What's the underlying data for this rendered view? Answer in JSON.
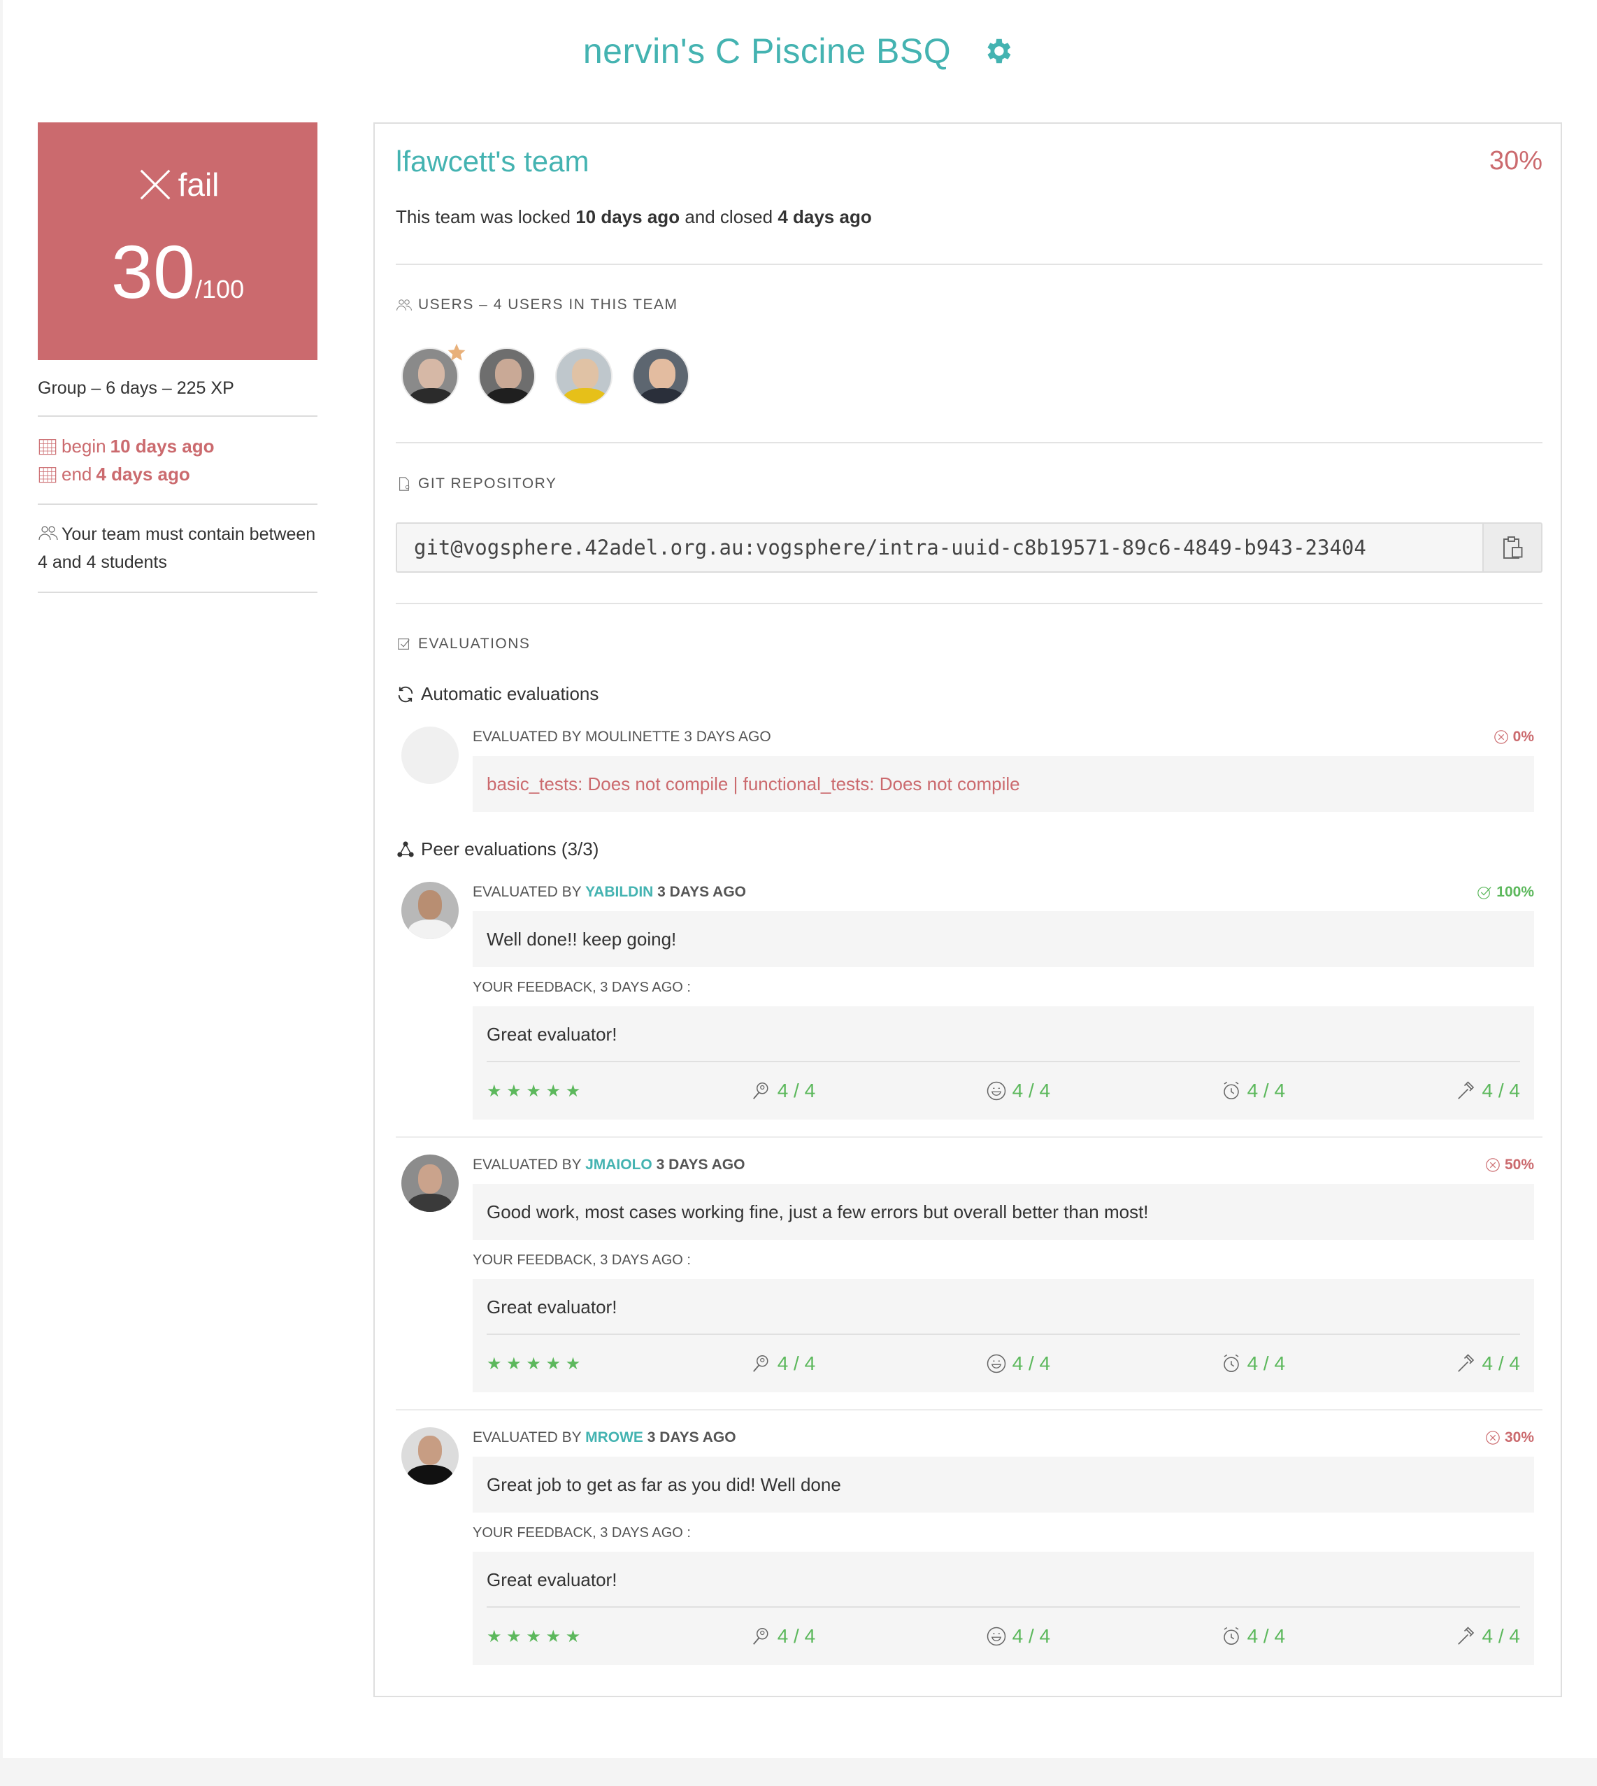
{
  "header": {
    "title": "nervin's C Piscine BSQ",
    "gear_icon": "gear-icon",
    "accent": "#44b3b1"
  },
  "mark": {
    "status": "fail",
    "score": "30",
    "denominator": "/100",
    "color": "#cb6a6e"
  },
  "sidebar": {
    "info": "Group – 6 days – 225 XP",
    "begin_label": "begin",
    "begin_value": "10 days ago",
    "end_label": "end",
    "end_value": "4 days ago",
    "team_size": "Your team must contain between 4 and 4 students"
  },
  "team": {
    "name": "lfawcett's team",
    "percent": "30%",
    "locked_prefix": "This team was locked",
    "locked_value": "10 days ago",
    "closed_prefix": "and closed",
    "closed_value": "4 days ago"
  },
  "users": {
    "label": "USERS – 4 USERS IN THIS TEAM",
    "avatars": [
      "user-avatar-1",
      "user-avatar-2",
      "user-avatar-3",
      "user-avatar-4"
    ]
  },
  "git": {
    "label": "GIT REPOSITORY",
    "url": "git@vogsphere.42adel.org.au:vogsphere/intra-uuid-c8b19571-89c6-4849-b943-23404",
    "copy_icon": "clipboard-icon"
  },
  "evaluations": {
    "label": "EVALUATIONS",
    "automatic_heading": "Automatic evaluations",
    "peer_heading": "Peer evaluations (3/3)",
    "automatic": {
      "title_prefix": "EVALUATED BY MOULINETTE 3 DAYS AGO",
      "score": "0%",
      "message": "basic_tests: Does not compile | functional_tests: Does not compile"
    },
    "peers": [
      {
        "prefix": "EVALUATED BY",
        "login": "YABILDIN",
        "ago": "3 DAYS AGO",
        "score": "100%",
        "status": "ok",
        "comment": "Well done!! keep going!",
        "feedback_label": "YOUR FEEDBACK, 3 DAYS AGO :",
        "feedback": "Great evaluator!",
        "stars": "★ ★ ★ ★ ★",
        "ratings": [
          "4 / 4",
          "4 / 4",
          "4 / 4",
          "4 / 4"
        ]
      },
      {
        "prefix": "EVALUATED BY",
        "login": "JMAIOLO",
        "ago": "3 DAYS AGO",
        "score": "50%",
        "status": "fail",
        "comment": "Good work, most cases working fine, just a few errors but overall better than most!",
        "feedback_label": "YOUR FEEDBACK, 3 DAYS AGO :",
        "feedback": "Great evaluator!",
        "stars": "★ ★ ★ ★ ★",
        "ratings": [
          "4 / 4",
          "4 / 4",
          "4 / 4",
          "4 / 4"
        ]
      },
      {
        "prefix": "EVALUATED BY",
        "login": "MROWE",
        "ago": "3 DAYS AGO",
        "score": "30%",
        "status": "fail",
        "comment": "Great job to get as far as you did! Well done",
        "feedback_label": "YOUR FEEDBACK, 3 DAYS AGO :",
        "feedback": "Great evaluator!",
        "stars": "★ ★ ★ ★ ★",
        "ratings": [
          "4 / 4",
          "4 / 4",
          "4 / 4",
          "4 / 4"
        ]
      }
    ]
  }
}
